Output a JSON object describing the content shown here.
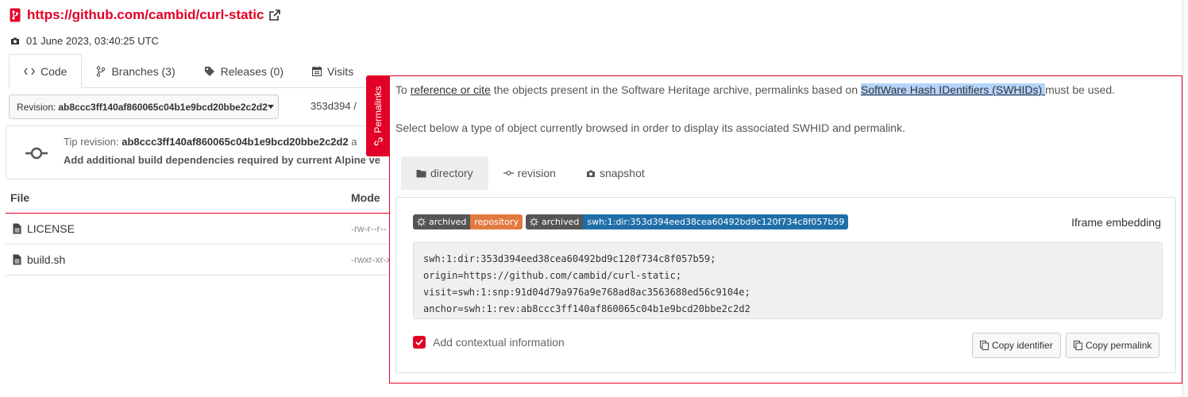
{
  "origin": {
    "url": "https://github.com/cambid/curl-static",
    "date": "01 June 2023, 03:40:25 UTC"
  },
  "tabs": [
    {
      "label": "Code"
    },
    {
      "label": "Branches (3)"
    },
    {
      "label": "Releases (0)"
    },
    {
      "label": "Visits"
    }
  ],
  "revision_select": {
    "prefix": "Revision:",
    "value": "ab8ccc3ff140af860065c04b1e9bcd20bbe2c2d2"
  },
  "breadcrumb": "353d394 /",
  "tip": {
    "label": "Tip revision:",
    "hash": "ab8ccc3ff140af860065c04b1e9bcd20bbe2c2d2",
    "tail": "a",
    "message": "Add additional build dependencies required by current Alpine ve"
  },
  "files": {
    "headers": [
      "File",
      "Mode"
    ],
    "rows": [
      {
        "name": "LICENSE",
        "mode": "-rw-r--r--"
      },
      {
        "name": "build.sh",
        "mode": "-rwxr-xr-x"
      }
    ]
  },
  "permalinks": {
    "tab_label": "Permalinks",
    "intro_before": "To ",
    "intro_link1": "reference or cite",
    "intro_middle": " the objects present in the Software Heritage archive, permalinks based on ",
    "intro_link2": "SoftWare Hash IDentifiers (SWHIDs) ",
    "intro_after": "must be used.",
    "select_text": "Select below a type of object currently browsed in order to display its associated SWHID and permalink.",
    "object_tabs": [
      {
        "label": "directory"
      },
      {
        "label": "revision"
      },
      {
        "label": "snapshot"
      }
    ],
    "badges": {
      "b1_left": "archived",
      "b1_right": "repository",
      "b2_left": "archived",
      "b2_right": "swh:1:dir:353d394eed38cea60492bd9c120f734c8f057b59"
    },
    "iframe_label": "Iframe embedding",
    "swhid_lines": [
      "swh:1:dir:353d394eed38cea60492bd9c120f734c8f057b59;",
      "origin=https://github.com/cambid/curl-static;",
      "visit=swh:1:snp:91d04d79a976a9e768ad8ac3563688ed56c9104e;",
      "anchor=swh:1:rev:ab8ccc3ff140af860065c04b1e9bcd20bbe2c2d2"
    ],
    "contextual_label": "Add contextual information",
    "copy_identifier": "Copy identifier",
    "copy_permalink": "Copy permalink"
  },
  "colors": {
    "accent": "#e20026",
    "badge_dark": "#555555",
    "badge_orange": "#e27a3f",
    "badge_blue": "#1f6ea8"
  }
}
